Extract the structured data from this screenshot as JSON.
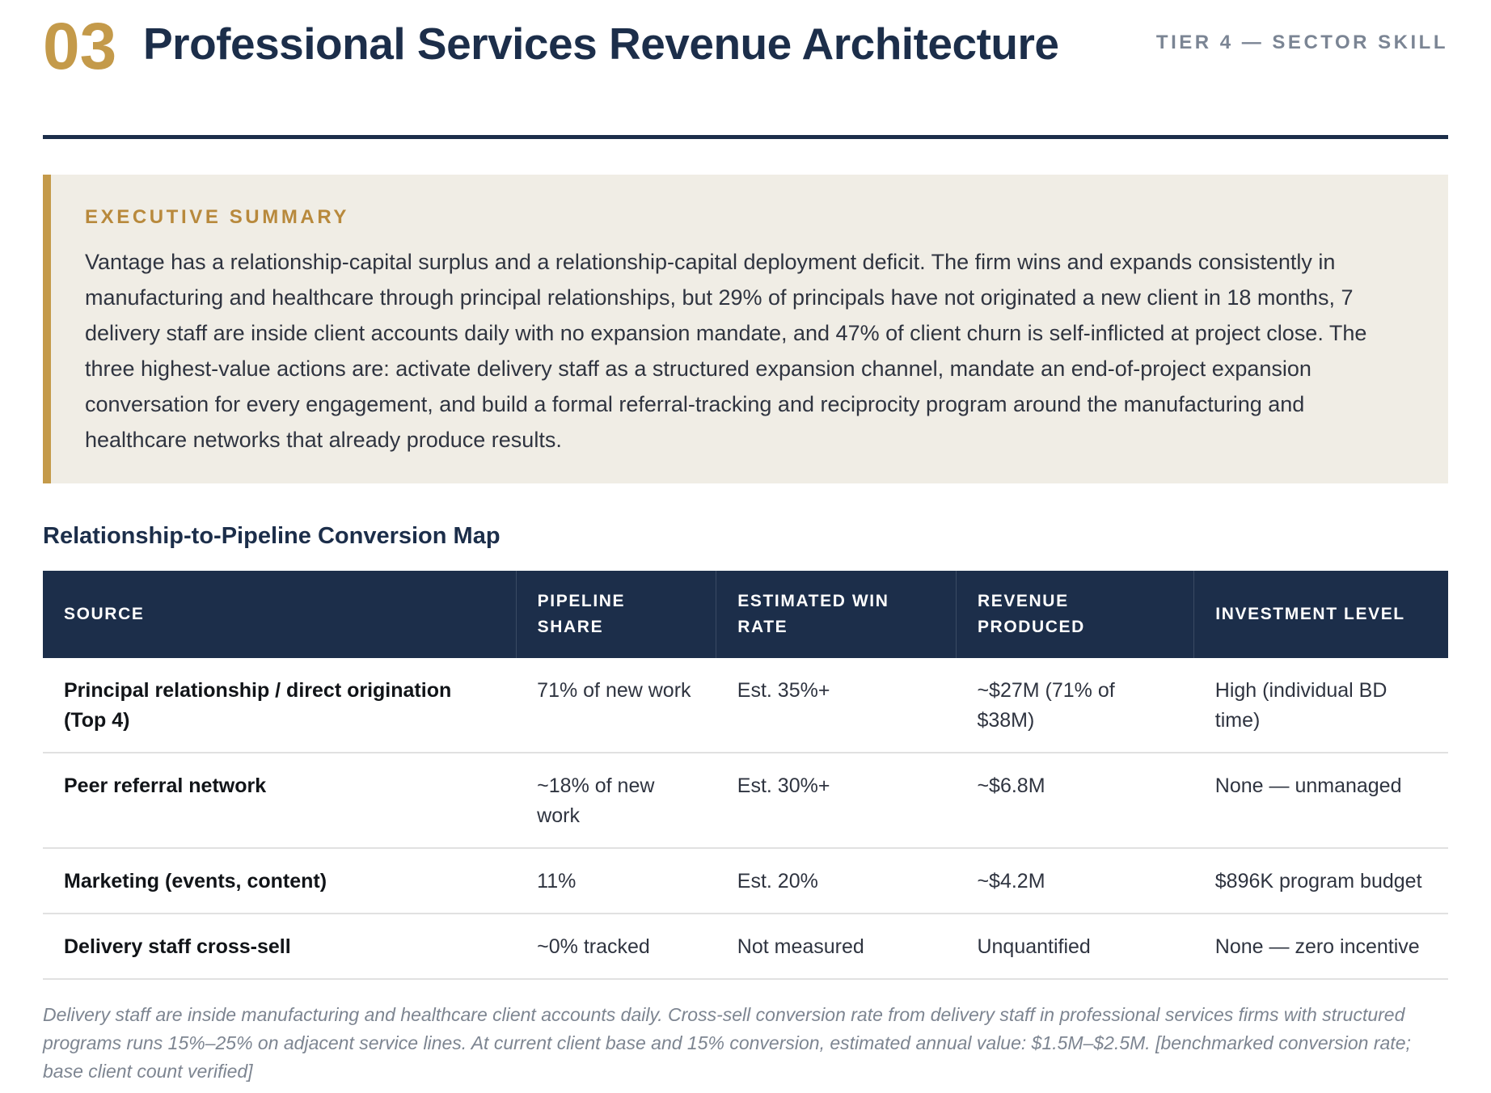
{
  "header": {
    "section_number": "03",
    "title": "Professional Services Revenue Architecture",
    "tier_label": "TIER 4 — SECTOR SKILL"
  },
  "summary": {
    "label": "EXECUTIVE SUMMARY",
    "text": "Vantage has a relationship-capital surplus and a relationship-capital deployment deficit. The firm wins and expands consistently in manufacturing and healthcare through principal relationships, but 29% of principals have not originated a new client in 18 months, 7 delivery staff are inside client accounts daily with no expansion mandate, and 47% of client churn is self-inflicted at project close. The three highest-value actions are: activate delivery staff as a structured expansion channel, mandate an end-of-project expansion conversation for every engagement, and build a formal referral-tracking and reciprocity program around the manufacturing and healthcare networks that already produce results."
  },
  "table": {
    "title": "Relationship-to-Pipeline Conversion Map",
    "columns": [
      "SOURCE",
      "PIPELINE SHARE",
      "ESTIMATED WIN RATE",
      "REVENUE PRODUCED",
      "INVESTMENT LEVEL"
    ],
    "rows": [
      [
        "Principal relationship / direct origination (Top 4)",
        "71% of new work",
        "Est. 35%+",
        "~$27M (71% of $38M)",
        "High (individual BD time)"
      ],
      [
        "Peer referral network",
        "~18% of new work",
        "Est. 30%+",
        "~$6.8M",
        "None — unmanaged"
      ],
      [
        "Marketing (events, content)",
        "11%",
        "Est. 20%",
        "~$4.2M",
        "$896K program budget"
      ],
      [
        "Delivery staff cross-sell",
        "~0% tracked",
        "Not measured",
        "Unquantified",
        "None — zero incentive"
      ]
    ]
  },
  "footnote": "Delivery staff are inside manufacturing and healthcare client accounts daily. Cross-sell conversion rate from delivery staff in professional services firms with structured programs runs 15%–25% on adjacent service lines. At current client base and 15% conversion, estimated annual value: $1.5M–$2.5M. [benchmarked conversion rate; base client count verified]",
  "colors": {
    "navy": "#1c2e4a",
    "gold": "#c49a4a",
    "summary_background": "#f0ede5"
  }
}
